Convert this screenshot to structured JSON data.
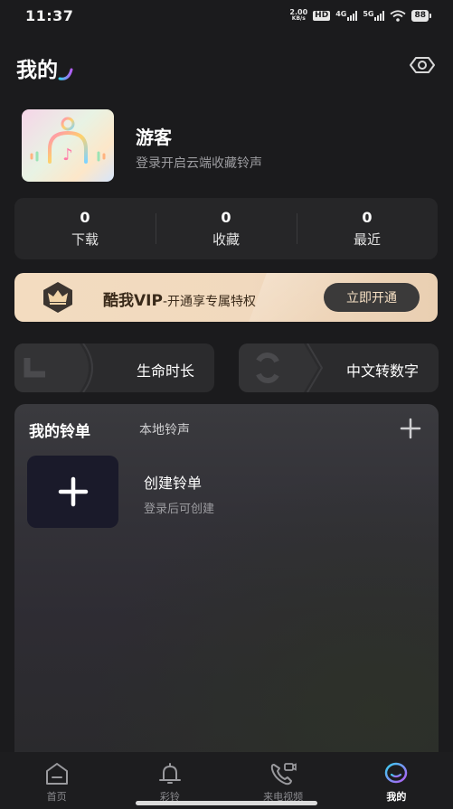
{
  "status_bar": {
    "time": "11:37",
    "speed_value": "2.00",
    "speed_unit": "KB/s",
    "hd_label": "HD",
    "net1_label": "4G",
    "net2_label": "5G",
    "battery": "88"
  },
  "header": {
    "title": "我的"
  },
  "profile": {
    "username": "游客",
    "hint": "登录开启云端收藏铃声"
  },
  "stats": [
    {
      "value": "0",
      "label": "下载"
    },
    {
      "value": "0",
      "label": "收藏"
    },
    {
      "value": "0",
      "label": "最近"
    }
  ],
  "vip": {
    "title": "酷我VIP",
    "subtitle": "-开通享专属特权",
    "button": "立即开通"
  },
  "features": {
    "left_label": "生命时长",
    "right_label": "中文转数字"
  },
  "playlist": {
    "tab_active": "我的铃单",
    "tab_inactive": "本地铃声",
    "create_title": "创建铃单",
    "create_hint": "登录后可创建"
  },
  "nav": {
    "items": [
      {
        "label": "首页",
        "icon": "home-icon"
      },
      {
        "label": "彩铃",
        "icon": "bell-icon"
      },
      {
        "label": "来电视频",
        "icon": "phone-video-icon"
      },
      {
        "label": "我的",
        "icon": "profile-icon"
      }
    ],
    "active_index": 3
  },
  "colors": {
    "background": "#1b1b1d",
    "card": "#262628",
    "vip_gold": "#f3dcc0",
    "vip_button": "#3b3a3a",
    "accent_gradient_start": "#38d0f0",
    "accent_gradient_end": "#b45cf5"
  }
}
